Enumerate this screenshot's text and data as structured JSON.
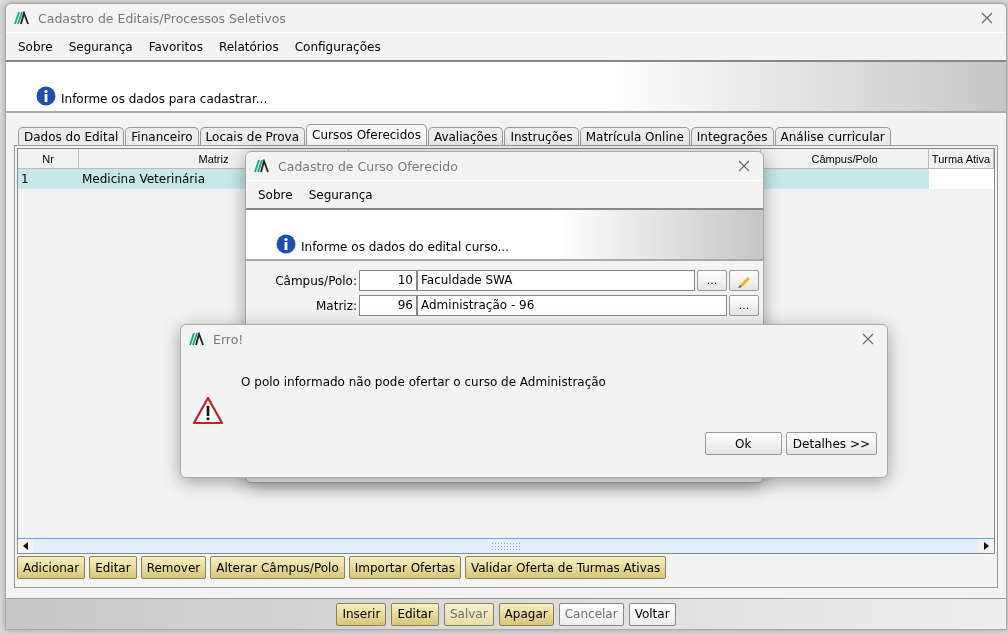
{
  "window": {
    "title": "Cadastro de Editais/Processos Seletivos"
  },
  "menu": [
    "Sobre",
    "Segurança",
    "Favoritos",
    "Relatórios",
    "Configurações"
  ],
  "banner": {
    "message": "Informe os dados para cadastrar..."
  },
  "tabs": [
    {
      "label": "Dados do Edital",
      "selected": false
    },
    {
      "label": "Financeiro",
      "selected": false
    },
    {
      "label": "Locais de Prova",
      "selected": false
    },
    {
      "label": "Cursos Oferecidos",
      "selected": true
    },
    {
      "label": "Avaliações",
      "selected": false
    },
    {
      "label": "Instruções",
      "selected": false
    },
    {
      "label": "Matrícula Online",
      "selected": false
    },
    {
      "label": "Integrações",
      "selected": false
    },
    {
      "label": "Análise curricular",
      "selected": false
    }
  ],
  "table": {
    "columns": [
      "Nr",
      "Matriz",
      "Câmpus/Polo",
      "Turma Ativa"
    ],
    "rows": [
      {
        "cells": [
          "1",
          "Medicina Veterinária"
        ],
        "selected": true
      }
    ]
  },
  "table_buttons": [
    "Adicionar",
    "Editar",
    "Remover",
    "Alterar Câmpus/Polo",
    "Importar Ofertas",
    "Validar Oferta de Turmas Ativas"
  ],
  "bottom_buttons": [
    {
      "label": "Inserir",
      "kind": "action",
      "disabled": false
    },
    {
      "label": "Editar",
      "kind": "action",
      "disabled": false
    },
    {
      "label": "Salvar",
      "kind": "action",
      "disabled": true
    },
    {
      "label": "Apagar",
      "kind": "action",
      "disabled": false
    },
    {
      "label": "Cancelar",
      "kind": "plain",
      "disabled": true
    },
    {
      "label": "Voltar",
      "kind": "plain",
      "disabled": false
    }
  ],
  "course_dialog": {
    "title": "Cadastro de Curso Oferecido",
    "menu": [
      "Sobre",
      "Segurança"
    ],
    "banner": "Informe os dados do edital curso...",
    "fields": [
      {
        "label": "Câmpus/Polo:",
        "code": "10",
        "value": "Faculdade SWA",
        "lookup": "...",
        "editable": true
      },
      {
        "label": "Matriz:",
        "code": "96",
        "value": "Administração - 96",
        "lookup": "...",
        "editable": false
      }
    ]
  },
  "error_dialog": {
    "title": "Erro!",
    "message": "O polo informado não pode ofertar o curso de Administração",
    "buttons": [
      "Ok",
      "Detalhes >>"
    ]
  }
}
